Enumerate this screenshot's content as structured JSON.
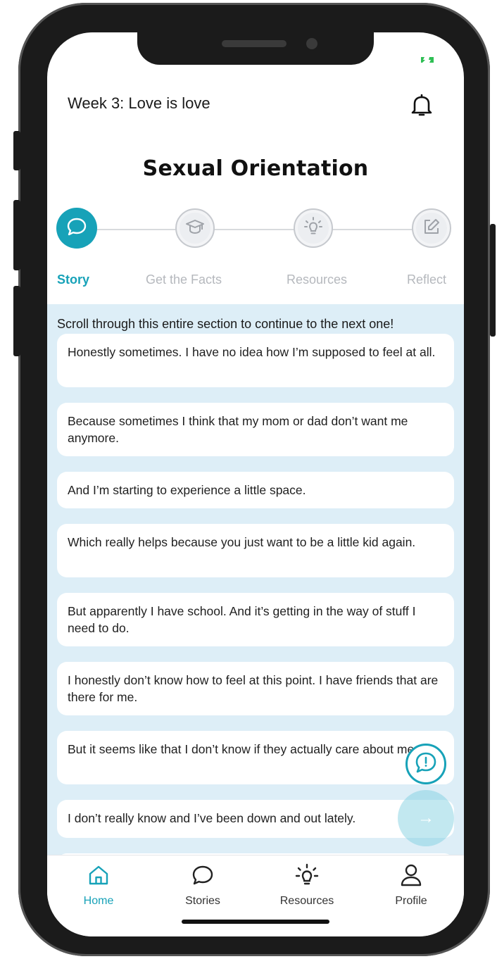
{
  "status_bar": {
    "battery_icon": "battery-charging-icon",
    "accent": "#2fbf55"
  },
  "header": {
    "week_title": "Week 3: Love is love",
    "bell_icon": "bell-icon"
  },
  "page_title": "Sexual Orientation",
  "accent_color": "#17a2b8",
  "steps": [
    {
      "label": "Story",
      "icon": "chat-bubble-icon",
      "active": true
    },
    {
      "label": "Get the Facts",
      "icon": "graduation-cap-icon",
      "active": false
    },
    {
      "label": "Resources",
      "icon": "lightbulb-icon",
      "active": false
    },
    {
      "label": "Reflect",
      "icon": "edit-icon",
      "active": false
    }
  ],
  "content": {
    "instruction": "Scroll through this entire section to continue to the next one!",
    "messages": [
      "Honestly sometimes. I have no idea how I’m supposed to feel at all.",
      "Because sometimes I think that my mom or dad don’t want me anymore.",
      "And I’m starting to experience a little space.",
      "Which really helps because you just want to be a little kid again.",
      "But apparently I have school. And it’s getting in the way of stuff I need to do.",
      "I honestly don’t know how to feel at this point. I have friends that are there for me.",
      "But it seems like that I don’t know if they actually care about me.",
      "I don’t really know and I’ve been down and out lately."
    ]
  },
  "fab": {
    "report_icon": "alert-chat-icon",
    "next_icon": "arrow-right-icon",
    "next_glyph": "→"
  },
  "tabbar": [
    {
      "label": "Home",
      "icon": "home-icon",
      "active": true
    },
    {
      "label": "Stories",
      "icon": "chat-bubble-icon",
      "active": false
    },
    {
      "label": "Resources",
      "icon": "lightbulb-icon",
      "active": false
    },
    {
      "label": "Profile",
      "icon": "user-icon",
      "active": false
    }
  ]
}
